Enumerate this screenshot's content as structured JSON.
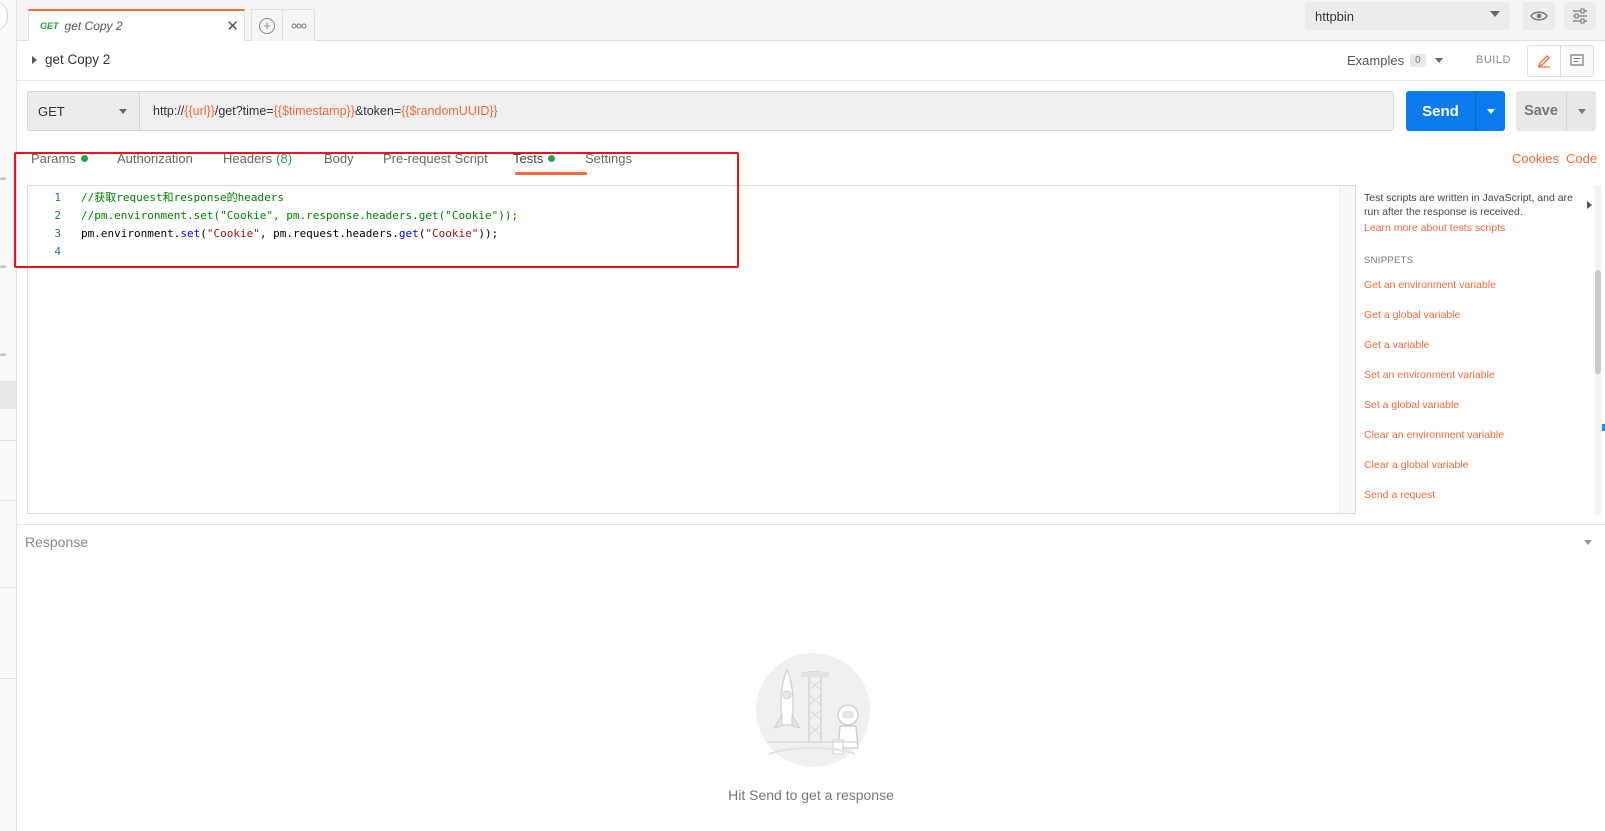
{
  "tab": {
    "method": "GET",
    "title": "get Copy 2"
  },
  "environment": {
    "selected": "httpbin"
  },
  "request": {
    "name": "get Copy 2",
    "examples_label": "Examples",
    "examples_count": "0",
    "build_label": "BUILD",
    "method": "GET",
    "url_parts": {
      "p1": "http://",
      "v1": "{{url}}",
      "p2": "/get?time=",
      "v2": "{{$timestamp}}",
      "p3": "&token=",
      "v3": "{{$randomUUID}}"
    },
    "send_label": "Send",
    "save_label": "Save"
  },
  "req_tabs": {
    "params": "Params",
    "authorization": "Authorization",
    "headers": "Headers",
    "headers_count": "(8)",
    "body": "Body",
    "prerequest": "Pre-request Script",
    "tests": "Tests",
    "settings": "Settings",
    "cookies": "Cookies",
    "code": "Code"
  },
  "editor": {
    "lines": [
      {
        "n": "1",
        "text": "//获取request和response的headers"
      },
      {
        "n": "2",
        "text": "//pm.environment.set(\"Cookie\", pm.response.headers.get(\"Cookie\"));"
      },
      {
        "n": "3",
        "t1": "pm.environment.",
        "t2": "set",
        "t3": "(",
        "t4": "\"Cookie\"",
        "t5": ", pm.request.headers.",
        "t6": "get",
        "t7": "(",
        "t8": "\"Cookie\"",
        "t9": "));"
      },
      {
        "n": "4",
        "text": ""
      }
    ]
  },
  "snippets": {
    "description": "Test scripts are written in JavaScript, and are run after the response is received.",
    "learn_more": "Learn more about tests scripts",
    "heading": "SNIPPETS",
    "items": [
      "Get an environment variable",
      "Get a global variable",
      "Get a variable",
      "Set an environment variable",
      "Set a global variable",
      "Clear an environment variable",
      "Clear a global variable",
      "Send a request"
    ]
  },
  "response": {
    "title": "Response",
    "hint": "Hit Send to get a response"
  },
  "colors": {
    "accent": "#f26b3a",
    "send": "#097bed",
    "status_green": "#2fa04b",
    "highlight": "#e8141b"
  }
}
